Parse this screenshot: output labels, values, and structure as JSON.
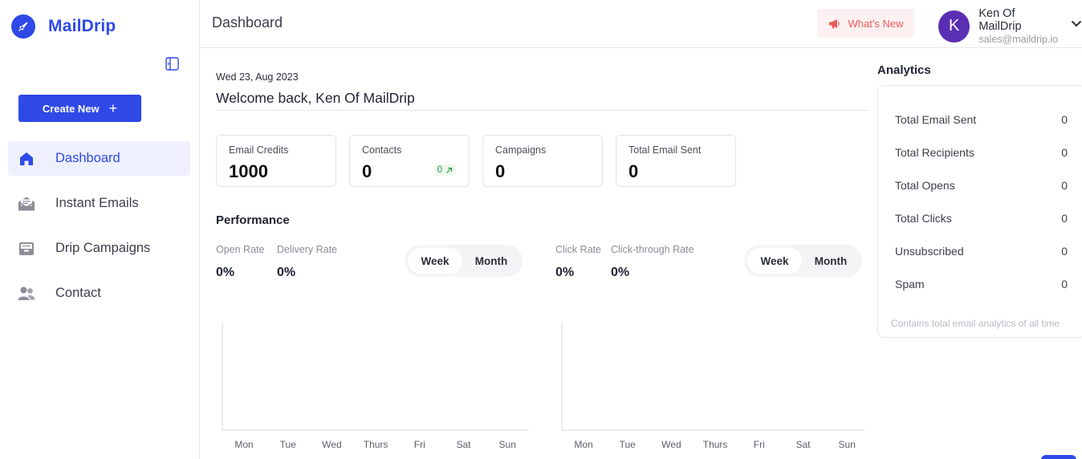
{
  "app": {
    "name": "MailDrip",
    "brand_color": "#2f49e6"
  },
  "sidebar": {
    "create_label": "Create New",
    "items": [
      {
        "label": "Dashboard",
        "icon": "home-icon",
        "active": true
      },
      {
        "label": "Instant Emails",
        "icon": "mail-open-icon",
        "active": false
      },
      {
        "label": "Drip Campaigns",
        "icon": "inbox-tray-icon",
        "active": false
      },
      {
        "label": "Contact",
        "icon": "users-icon",
        "active": false
      }
    ]
  },
  "header": {
    "title": "Dashboard",
    "whats_new": "What's New",
    "user": {
      "initial": "K",
      "name": "Ken Of MailDrip",
      "email": "sales@maildrip.io",
      "avatar_color": "#5b2fb4"
    }
  },
  "main": {
    "date": "Wed 23, Aug 2023",
    "welcome": "Welcome back, Ken Of MailDrip",
    "stats": [
      {
        "label": "Email Credits",
        "value": "1000"
      },
      {
        "label": "Contacts",
        "value": "0",
        "trend": "0"
      },
      {
        "label": "Campaigns",
        "value": "0"
      },
      {
        "label": "Total Email Sent",
        "value": "0"
      }
    ],
    "performance": {
      "title": "Performance",
      "left": {
        "metrics": [
          {
            "label": "Open Rate",
            "value": "0%"
          },
          {
            "label": "Delivery Rate",
            "value": "0%"
          }
        ],
        "toggle": {
          "week": "Week",
          "month": "Month",
          "selected": "Week"
        },
        "days": [
          "Mon",
          "Tue",
          "Wed",
          "Thurs",
          "Fri",
          "Sat",
          "Sun"
        ]
      },
      "right": {
        "metrics": [
          {
            "label": "Click Rate",
            "value": "0%"
          },
          {
            "label": "Click-through Rate",
            "value": "0%"
          }
        ],
        "toggle": {
          "week": "Week",
          "month": "Month",
          "selected": "Week"
        },
        "days": [
          "Mon",
          "Tue",
          "Wed",
          "Thurs",
          "Fri",
          "Sat",
          "Sun"
        ]
      }
    }
  },
  "analytics": {
    "title": "Analytics",
    "rows": [
      {
        "label": "Total Email Sent",
        "value": "0"
      },
      {
        "label": "Total Recipients",
        "value": "0"
      },
      {
        "label": "Total Opens",
        "value": "0"
      },
      {
        "label": "Total Clicks",
        "value": "0"
      },
      {
        "label": "Unsubscribed",
        "value": "0"
      },
      {
        "label": "Spam",
        "value": "0"
      }
    ],
    "note": "Contains total email analytics of all time"
  },
  "chart_data": [
    {
      "type": "line",
      "categories": [
        "Mon",
        "Tue",
        "Wed",
        "Thurs",
        "Fri",
        "Sat",
        "Sun"
      ],
      "series": []
    },
    {
      "type": "line",
      "categories": [
        "Mon",
        "Tue",
        "Wed",
        "Thurs",
        "Fri",
        "Sat",
        "Sun"
      ],
      "series": []
    }
  ]
}
